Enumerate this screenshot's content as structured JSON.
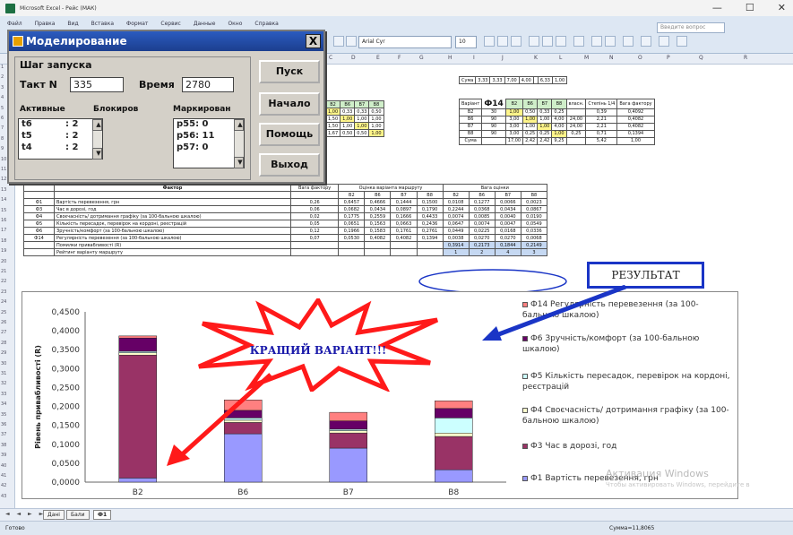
{
  "window": {
    "title": "Microsoft Excel - Рейс (МАК)",
    "controls": [
      "—",
      "☐",
      "✕"
    ],
    "font_name": "Arial Cyr",
    "font_size": "10",
    "search_placeholder": "Введите вопрос"
  },
  "menu": [
    "Файл",
    "Правка",
    "Вид",
    "Вставка",
    "Формат",
    "Сервис",
    "Данные",
    "Окно",
    "Справка"
  ],
  "columns": [
    "C",
    "D",
    "E",
    "F",
    "G",
    "H",
    "I",
    "J",
    "K",
    "L",
    "M",
    "N",
    "O",
    "P",
    "Q",
    "R"
  ],
  "rows": [
    "1",
    "2",
    "3",
    "4",
    "5",
    "6",
    "7",
    "8",
    "9",
    "10",
    "11",
    "12",
    "13",
    "14",
    "15",
    "16",
    "17",
    "18",
    "19",
    "20",
    "21",
    "22",
    "23",
    "24",
    "25",
    "26",
    "27",
    "28",
    "29",
    "30",
    "31",
    "32",
    "33",
    "34",
    "35",
    "36",
    "37",
    "38",
    "39",
    "40",
    "41",
    "42",
    "43"
  ],
  "dialog": {
    "title": "Моделирование",
    "close": "X",
    "step_label": "Шаг запуска",
    "tact_label": "Такт N",
    "tact_value": "335",
    "time_label": "Время",
    "time_value": "2780",
    "active_label": "Активные",
    "blocked_label": "Блокиров",
    "marked_label": "Маркирован",
    "active_list": [
      {
        "id": "t6",
        "val": ": 2"
      },
      {
        "id": "t5",
        "val": ": 2"
      },
      {
        "id": "t4",
        "val": ": 2"
      }
    ],
    "marked_list": [
      "p55: 0",
      "p56: 11",
      "p57: 0"
    ],
    "buttons": {
      "start": "Пуск",
      "begin": "Начало",
      "help": "Помощь",
      "exit": "Выход"
    }
  },
  "top_tables": {
    "left": {
      "headers": [
        "В2",
        "В6",
        "В7",
        "В8"
      ],
      "rows": [
        [
          "1,00",
          "0,33",
          "0,33",
          "0,50"
        ],
        [
          "1,50",
          "1,00",
          "1,00",
          "1,00"
        ],
        [
          "1,50",
          "1,00",
          "1,00",
          "1,00"
        ],
        [
          "1,67",
          "0,50",
          "0,50",
          "1,00"
        ]
      ]
    },
    "right": {
      "title": "Ф14",
      "head_cols": [
        "Варіант",
        "В2",
        "В6",
        "В7",
        "В8",
        "власн.",
        "Степінь 1/4",
        "Вага фактору"
      ],
      "summary_top": [
        "Сума",
        "3,33",
        "3,33",
        "7,00",
        "4,00",
        "",
        "6,33",
        "1,00"
      ],
      "rows": [
        [
          "В2",
          "30",
          "1,00",
          "0,50",
          "0,33",
          "0,25",
          "",
          "0,39",
          "0,4092"
        ],
        [
          "В6",
          "90",
          "3,00",
          "1,00",
          "1,00",
          "4,00",
          "24,00",
          "2,21",
          "0,4082"
        ],
        [
          "В7",
          "90",
          "3,00",
          "1,00",
          "1,00",
          "4,00",
          "24,00",
          "2,21",
          "0,4082"
        ],
        [
          "В8",
          "90",
          "3,00",
          "0,25",
          "0,25",
          "1,00",
          "0,25",
          "0,71",
          "0,1394"
        ]
      ],
      "summary": [
        "Сума",
        "",
        "17,00",
        "2,42",
        "2,42",
        "9,25",
        "",
        "5,42",
        "1,00"
      ]
    }
  },
  "factor_table": {
    "header_factor": "Фактор",
    "header_weight": "Вага фактору",
    "header_eval": "Оцінка варіанта маршруту",
    "header_eval_weighted": "Вага оцінки",
    "variants": [
      "В2",
      "В6",
      "В7",
      "В8"
    ],
    "rows": [
      {
        "code": "Ф1",
        "name": "Вартість перевезення, грн",
        "w": "0,26",
        "e": [
          "0,6457",
          "0,4666",
          "0,1444",
          "0,1500"
        ],
        "ew": [
          "0,0108",
          "0,1277",
          "0,0066",
          "0,0023"
        ]
      },
      {
        "code": "Ф3",
        "name": "Час в дорозі, год",
        "w": "0,06",
        "e": [
          "0,0682",
          "0,0434",
          "0,0897",
          "0,1790"
        ],
        "ew": [
          "0,2244",
          "0,0368",
          "0,0434",
          "0,0867"
        ]
      },
      {
        "code": "Ф4",
        "name": "Своєчасність/ дотримання графіку (за 100-бальною шкалою)",
        "w": "0,02",
        "e": [
          "0,1775",
          "0,2559",
          "0,1666",
          "0,4433"
        ],
        "ew": [
          "0,0074",
          "0,0085",
          "0,0040",
          "0,0190"
        ]
      },
      {
        "code": "Ф5",
        "name": "Кількість пересадок, перевірок на кордоні, реєстрацій",
        "w": "0,05",
        "e": [
          "0,0651",
          "0,1563",
          "0,0663",
          "0,2436"
        ],
        "ew": [
          "0,0647",
          "0,0074",
          "0,0047",
          "0,0549"
        ]
      },
      {
        "code": "Ф6",
        "name": "Зручність/комфорт (за 100-бальною шкалою)",
        "w": "0,12",
        "e": [
          "0,1966",
          "0,1583",
          "0,1761",
          "0,2761"
        ],
        "ew": [
          "0,0449",
          "0,0225",
          "0,0168",
          "0,0336"
        ]
      },
      {
        "code": "Ф14",
        "name": "Регулярність перевезення (за 100-бальною шкалою)",
        "w": "0,07",
        "e": [
          "0,0530",
          "0,4082",
          "0,4082",
          "0,1394"
        ],
        "ew": [
          "0,0038",
          "0,0270",
          "0,0270",
          "0,0068"
        ]
      }
    ],
    "total_label": "Помилки привабливості (R)",
    "totals": [
      "0,3914",
      "0,2173",
      "0,1844",
      "0,2149"
    ],
    "rank_label": "Рейтинг варіанту маршруту",
    "ranks": [
      "1",
      "2",
      "4",
      "3"
    ]
  },
  "chart_data": {
    "type": "bar",
    "stacked": true,
    "categories": [
      "В2",
      "В6",
      "В7",
      "В8"
    ],
    "ylabel": "Рівень привабливості (R)",
    "ylim": [
      0,
      0.45
    ],
    "yticks": [
      "0,4500",
      "0,4000",
      "0,3500",
      "0,3000",
      "0,2500",
      "0,2000",
      "0,1500",
      "0,1000",
      "0,0500",
      "0,0000"
    ],
    "grid": false,
    "legend_position": "right",
    "series": [
      {
        "name": "Ф1 Вартість перевезення, грн",
        "color": "#9999ff",
        "values": [
          0.0108,
          0.1277,
          0.0899,
          0.0327
        ]
      },
      {
        "name": "Ф3 Час в дорозі, год",
        "color": "#993366",
        "values": [
          0.325,
          0.03,
          0.04,
          0.088
        ]
      },
      {
        "name": "Ф4 Своєчасність/ дотримання графіку (за 100-бальною шкалою)",
        "color": "#ffffcc",
        "values": [
          0.006,
          0.006,
          0.006,
          0.009
        ]
      },
      {
        "name": "Ф5 Кількість пересадок, перевірок на кордоні, реєстрацій",
        "color": "#ccffff",
        "values": [
          0.004,
          0.006,
          0.004,
          0.04
        ]
      },
      {
        "name": "Ф6 Зручність/комфорт (за 100-бальною шкалою)",
        "color": "#660066",
        "values": [
          0.035,
          0.02,
          0.022,
          0.025
        ]
      },
      {
        "name": "Ф14 Регулярність перевезення (за 100-бальною шкалою)",
        "color": "#ff8080",
        "values": [
          0.0056,
          0.0276,
          0.0225,
          0.0202
        ]
      }
    ]
  },
  "annotations": {
    "result": "РЕЗУЛЬТАТ",
    "best": "КРАЩИЙ ВАРІАНТ!!!"
  },
  "sheet_tabs": [
    "Дані",
    "Бали",
    "Ф1"
  ],
  "status": {
    "ready": "Готово",
    "sum": "Сумма=11,8065"
  },
  "watermark": {
    "line1": "Активация Windows",
    "line2": "Чтобы активировать Windows, перейдите в"
  },
  "colors": {
    "accent": "#1a35c6",
    "burst": "#ff1a1a",
    "dialog_title": "#2b5bbf"
  }
}
